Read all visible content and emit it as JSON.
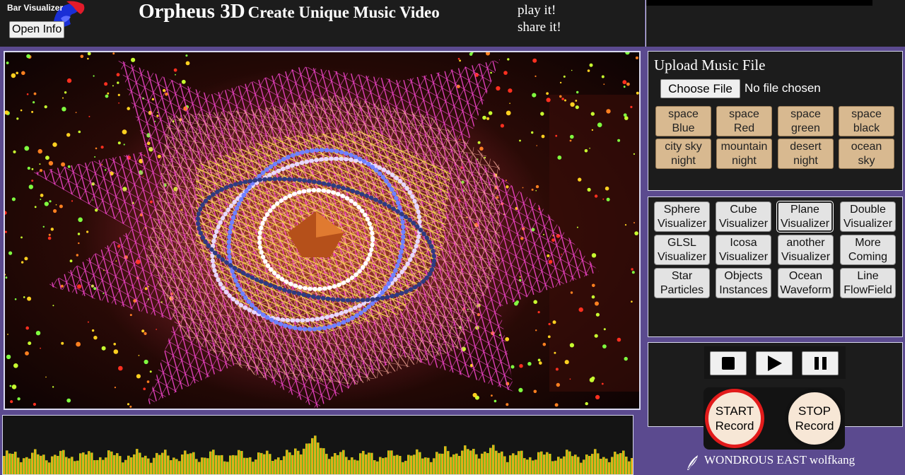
{
  "header": {
    "open_info_label": "Open Info",
    "title_main": "Orpheus 3D",
    "title_sub": "Create Unique Music Video",
    "tagline_1": "play it!",
    "tagline_2": "share it!"
  },
  "bar_visualizer": {
    "label": "Bar Visualizer"
  },
  "upload": {
    "title": "Upload Music File",
    "choose_file_label": "Choose File",
    "file_status": "No file chosen"
  },
  "scenes": [
    {
      "line1": "space",
      "line2": "Blue"
    },
    {
      "line1": "space",
      "line2": "Red"
    },
    {
      "line1": "space",
      "line2": "green"
    },
    {
      "line1": "space",
      "line2": "black"
    },
    {
      "line1": "city sky",
      "line2": "night"
    },
    {
      "line1": "mountain",
      "line2": "night"
    },
    {
      "line1": "desert",
      "line2": "night"
    },
    {
      "line1": "ocean",
      "line2": "sky"
    }
  ],
  "visualizers": [
    {
      "line1": "Sphere",
      "line2": "Visualizer"
    },
    {
      "line1": "Cube",
      "line2": "Visualizer"
    },
    {
      "line1": "Plane",
      "line2": "Visualizer"
    },
    {
      "line1": "Double",
      "line2": "Visualizer"
    },
    {
      "line1": "GLSL",
      "line2": "Visualizer"
    },
    {
      "line1": "Icosa",
      "line2": "Visualizer"
    },
    {
      "line1": "another",
      "line2": "Visualizer"
    },
    {
      "line1": "More",
      "line2": "Coming"
    },
    {
      "line1": "Star",
      "line2": "Particles"
    },
    {
      "line1": "Objects",
      "line2": "Instances"
    },
    {
      "line1": "Ocean",
      "line2": "Waveform"
    },
    {
      "line1": "Line",
      "line2": "FlowField"
    }
  ],
  "controls": {
    "start_line1": "START",
    "start_line2": "Record",
    "stop_line1": "STOP",
    "stop_line2": "Record"
  },
  "footer": {
    "credit": "WONDROUS EAST wolfkang"
  },
  "colors": {
    "background": "#5b4a8f",
    "panel": "#1c1c1c",
    "scene_button": "#d8b990",
    "record_start_ring": "#e21b1b",
    "wireframe_pink": "#ff40d0",
    "wireframe_yellow": "#ffe040"
  }
}
